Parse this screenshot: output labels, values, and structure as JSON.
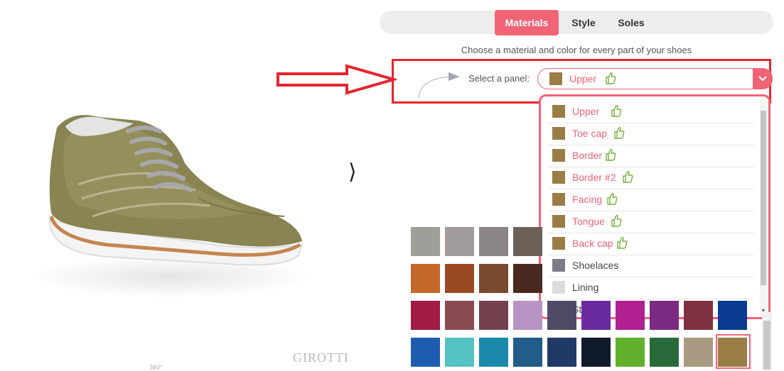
{
  "tabs": [
    {
      "label": "Materials",
      "active": true
    },
    {
      "label": "Style",
      "active": false
    },
    {
      "label": "Soles",
      "active": false
    }
  ],
  "subtitle": "Choose a material and color for every part of your shoes",
  "panel_selector": {
    "label": "Select a panel:",
    "selected": "Upper",
    "selected_color": "#9a7c45"
  },
  "panel_options": [
    {
      "label": "Upper",
      "color": "#9a7c45",
      "recommended": true
    },
    {
      "label": "Toe cap",
      "color": "#9a7c45",
      "recommended": true
    },
    {
      "label": "Border",
      "color": "#9a7c45",
      "recommended": true
    },
    {
      "label": "Border #2",
      "color": "#9a7c45",
      "recommended": true
    },
    {
      "label": "Facing",
      "color": "#9a7c45",
      "recommended": true
    },
    {
      "label": "Tongue",
      "color": "#9a7c45",
      "recommended": true
    },
    {
      "label": "Back cap",
      "color": "#9a7c45",
      "recommended": true
    },
    {
      "label": "Shoelaces",
      "color": "#7d7c86",
      "recommended": false
    },
    {
      "label": "Lining",
      "color": "#dcdcdc",
      "recommended": false
    },
    {
      "label": "Stitching",
      "color": "#efefef",
      "recommended": false
    }
  ],
  "swatch_rows": [
    [
      "#a09e99",
      "#a29c9c",
      "#8c8585",
      "#6e5f58"
    ],
    [
      "#c4682a",
      "#9a4a22",
      "#7a4a30",
      "#4a2a20"
    ],
    [
      "#a31a45",
      "#8a4a52",
      "#74404e",
      "#b894c4",
      "#4e4a66",
      "#6a2aa0",
      "#b02090",
      "#7a2a80",
      "#803040",
      "#0a3a90"
    ],
    [
      "#1e5cb0",
      "#55c2c4",
      "#1a88a8",
      "#225c88",
      "#1f3a66",
      "#101a2a",
      "#60b02c",
      "#2a6a3a",
      "#a89a80",
      "#9a7c45"
    ]
  ],
  "selected_swatch": "#9a7c45",
  "icons": {
    "recommended": "thumbs-up-icon",
    "dropdown": "chevron-down-icon",
    "next": "chevron-right-icon"
  },
  "brand": "GIROTTI",
  "rotate_hint": "360°",
  "colors": {
    "accent": "#f16476",
    "annotation_red": "#e8232e",
    "thumb_green": "#76b041"
  }
}
